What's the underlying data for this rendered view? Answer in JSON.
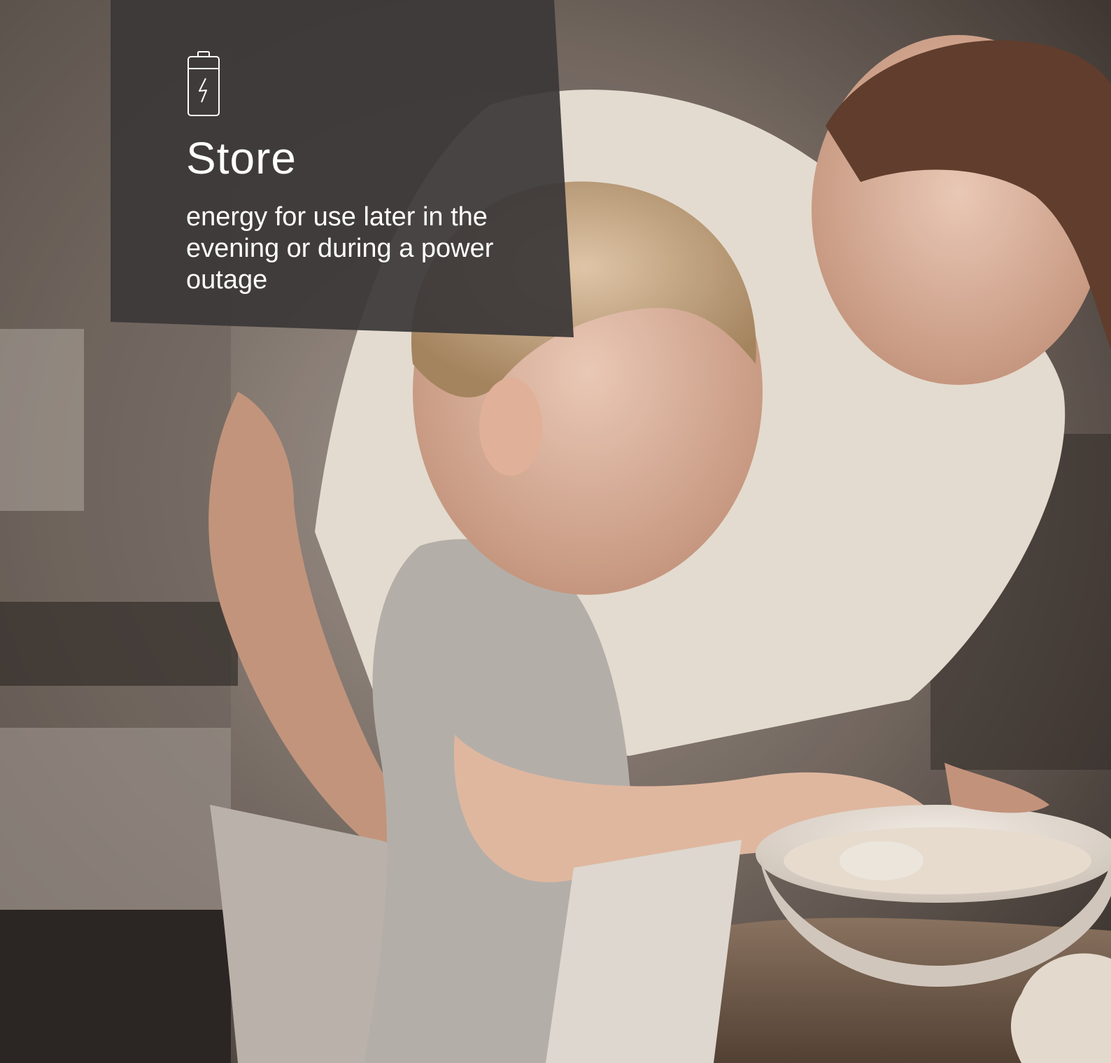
{
  "panel": {
    "icon": "battery-charging-icon",
    "title": "Store",
    "subtitle": "energy for use later in the evening or during a power outage"
  },
  "photo": {
    "subject": "mother-and-child-cracking-eggs"
  },
  "colors": {
    "panel": "#3b3838",
    "text": "#ffffff"
  }
}
